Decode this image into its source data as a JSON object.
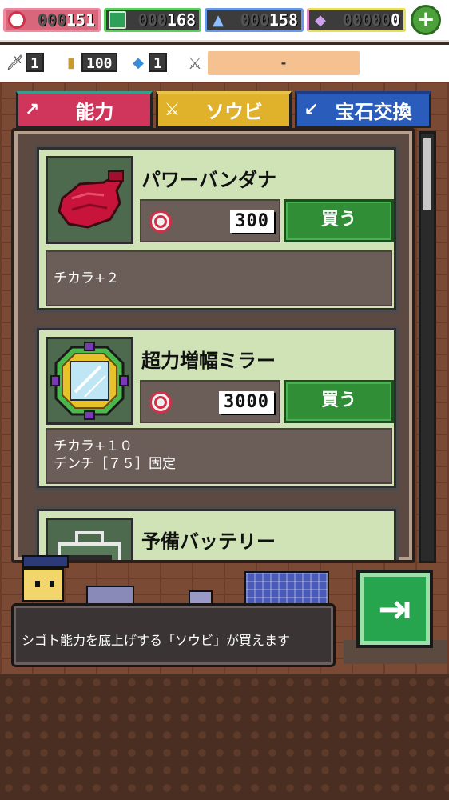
{
  "currencies": [
    {
      "name": "coin",
      "icon": "coin-icon",
      "color": "#f08aa0",
      "dim": "000",
      "value": "151"
    },
    {
      "name": "gem-green",
      "icon": "green-gem-icon",
      "color": "#5ccf5c",
      "dim": "000",
      "value": "168"
    },
    {
      "name": "pyramid",
      "icon": "triangle-icon",
      "color": "#6a9ae6",
      "dim": "000",
      "value": "158"
    },
    {
      "name": "diamond",
      "icon": "diamond-icon",
      "color": "#e8e05c",
      "dim": "00000",
      "value": "0"
    }
  ],
  "plus_label": "+",
  "stats": [
    {
      "icon": "sword-icon",
      "value": "1"
    },
    {
      "icon": "battery-icon",
      "value": "100"
    },
    {
      "icon": "crystal-icon",
      "value": "1"
    }
  ],
  "stat_bar_text": "-",
  "tabs": [
    {
      "label": "能力",
      "icon": "arrow-icon"
    },
    {
      "label": "ソウビ",
      "icon": "sword-icon"
    },
    {
      "label": "宝石交換",
      "icon": "arrow-icon"
    }
  ],
  "items": [
    {
      "name": "パワーバンダナ",
      "icon": "bandana-icon",
      "price": "300",
      "buy_label": "買う",
      "desc_lines": [
        "チカラ+２"
      ]
    },
    {
      "name": "超力増幅ミラー",
      "icon": "mirror-icon",
      "price": "3000",
      "buy_label": "買う",
      "desc_lines": [
        "チカラ+１０",
        "デンチ［７５］固定"
      ]
    },
    {
      "name": "予備バッテリー",
      "icon": "battery-pack-icon"
    }
  ],
  "speech_text": "シゴト能力を底上げする「ソウビ」が買えます",
  "exit_icon": "exit-door-icon"
}
